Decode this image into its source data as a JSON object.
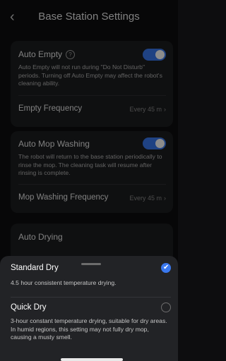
{
  "header": {
    "title": "Base Station Settings",
    "back_icon": "chevron-left-icon"
  },
  "auto_empty": {
    "title": "Auto Empty",
    "info_icon": "?",
    "description": "Auto Empty will not run during \"Do Not Disturb\" periods. Turning off Auto Empty may affect the robot's cleaning ability.",
    "enabled": true,
    "frequency_label": "Empty Frequency",
    "frequency_value": "Every 45 m"
  },
  "auto_mop_washing": {
    "title": "Auto Mop Washing",
    "description": "The robot will return to the base station periodically to rinse the mop. The cleaning task will resume after rinsing is complete.",
    "enabled": true,
    "frequency_label": "Mop Washing Frequency",
    "frequency_value": "Every 45 m"
  },
  "auto_drying": {
    "title": "Auto Drying"
  },
  "sheet": {
    "options": [
      {
        "title": "Standard Dry",
        "description": "4.5 hour consistent temperature drying.",
        "selected": true
      },
      {
        "title": "Quick Dry",
        "description": "3-hour constant temperature drying, suitable for dry areas. In humid regions, this setting may not fully dry mop, causing a musty smell.",
        "selected": false
      }
    ]
  },
  "colors": {
    "accent": "#3a78ee",
    "background": "#0d0d0f",
    "card": "#1d1e20",
    "sheet": "#222326"
  }
}
